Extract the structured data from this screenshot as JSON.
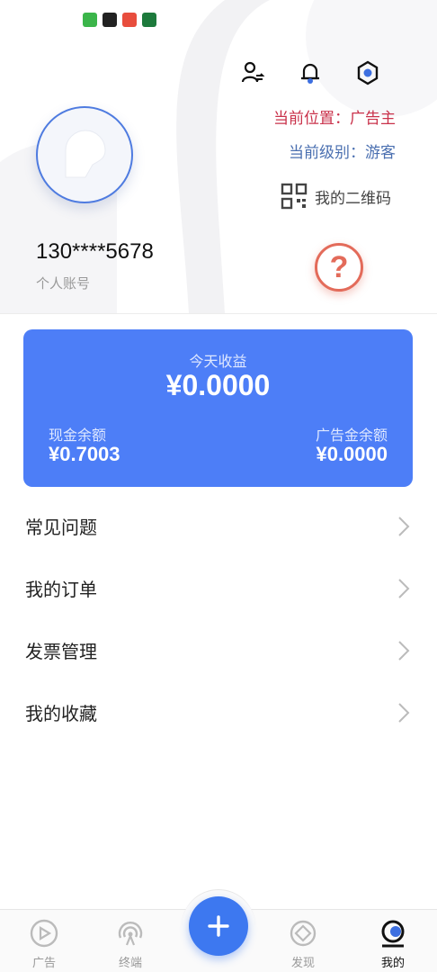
{
  "header": {
    "account_number": "130****5678",
    "account_label": "个人账号",
    "position_line": "当前位置：广告主",
    "level_line": "当前级别：游客",
    "qr_label": "我的二维码",
    "help_symbol": "?"
  },
  "icons": {
    "switch_user": "user-switch-icon",
    "notification": "bell-icon",
    "settings": "gear-icon",
    "qr": "qr-code-icon",
    "help": "help-icon"
  },
  "earnings": {
    "today_label": "今天收益",
    "today_value": "¥0.0000",
    "cash_label": "现金余额",
    "cash_value": "¥0.7003",
    "ad_label": "广告金余额",
    "ad_value": "¥0.0000"
  },
  "menu": {
    "items": [
      {
        "label": "常见问题"
      },
      {
        "label": "我的订单"
      },
      {
        "label": "发票管理"
      },
      {
        "label": "我的收藏"
      }
    ]
  },
  "bottom_nav": {
    "items": [
      {
        "label": "广告",
        "icon": "play-icon",
        "active": false
      },
      {
        "label": "终端",
        "icon": "broadcast-icon",
        "active": false
      },
      {
        "label": "发现",
        "icon": "discover-icon",
        "active": false
      },
      {
        "label": "我的",
        "icon": "profile-icon",
        "active": true
      }
    ],
    "fab_symbol": "+"
  },
  "colors": {
    "accent": "#4d7ef7",
    "position_text": "#c9314a",
    "level_text": "#4a6fb0",
    "help": "#e36b5a"
  }
}
